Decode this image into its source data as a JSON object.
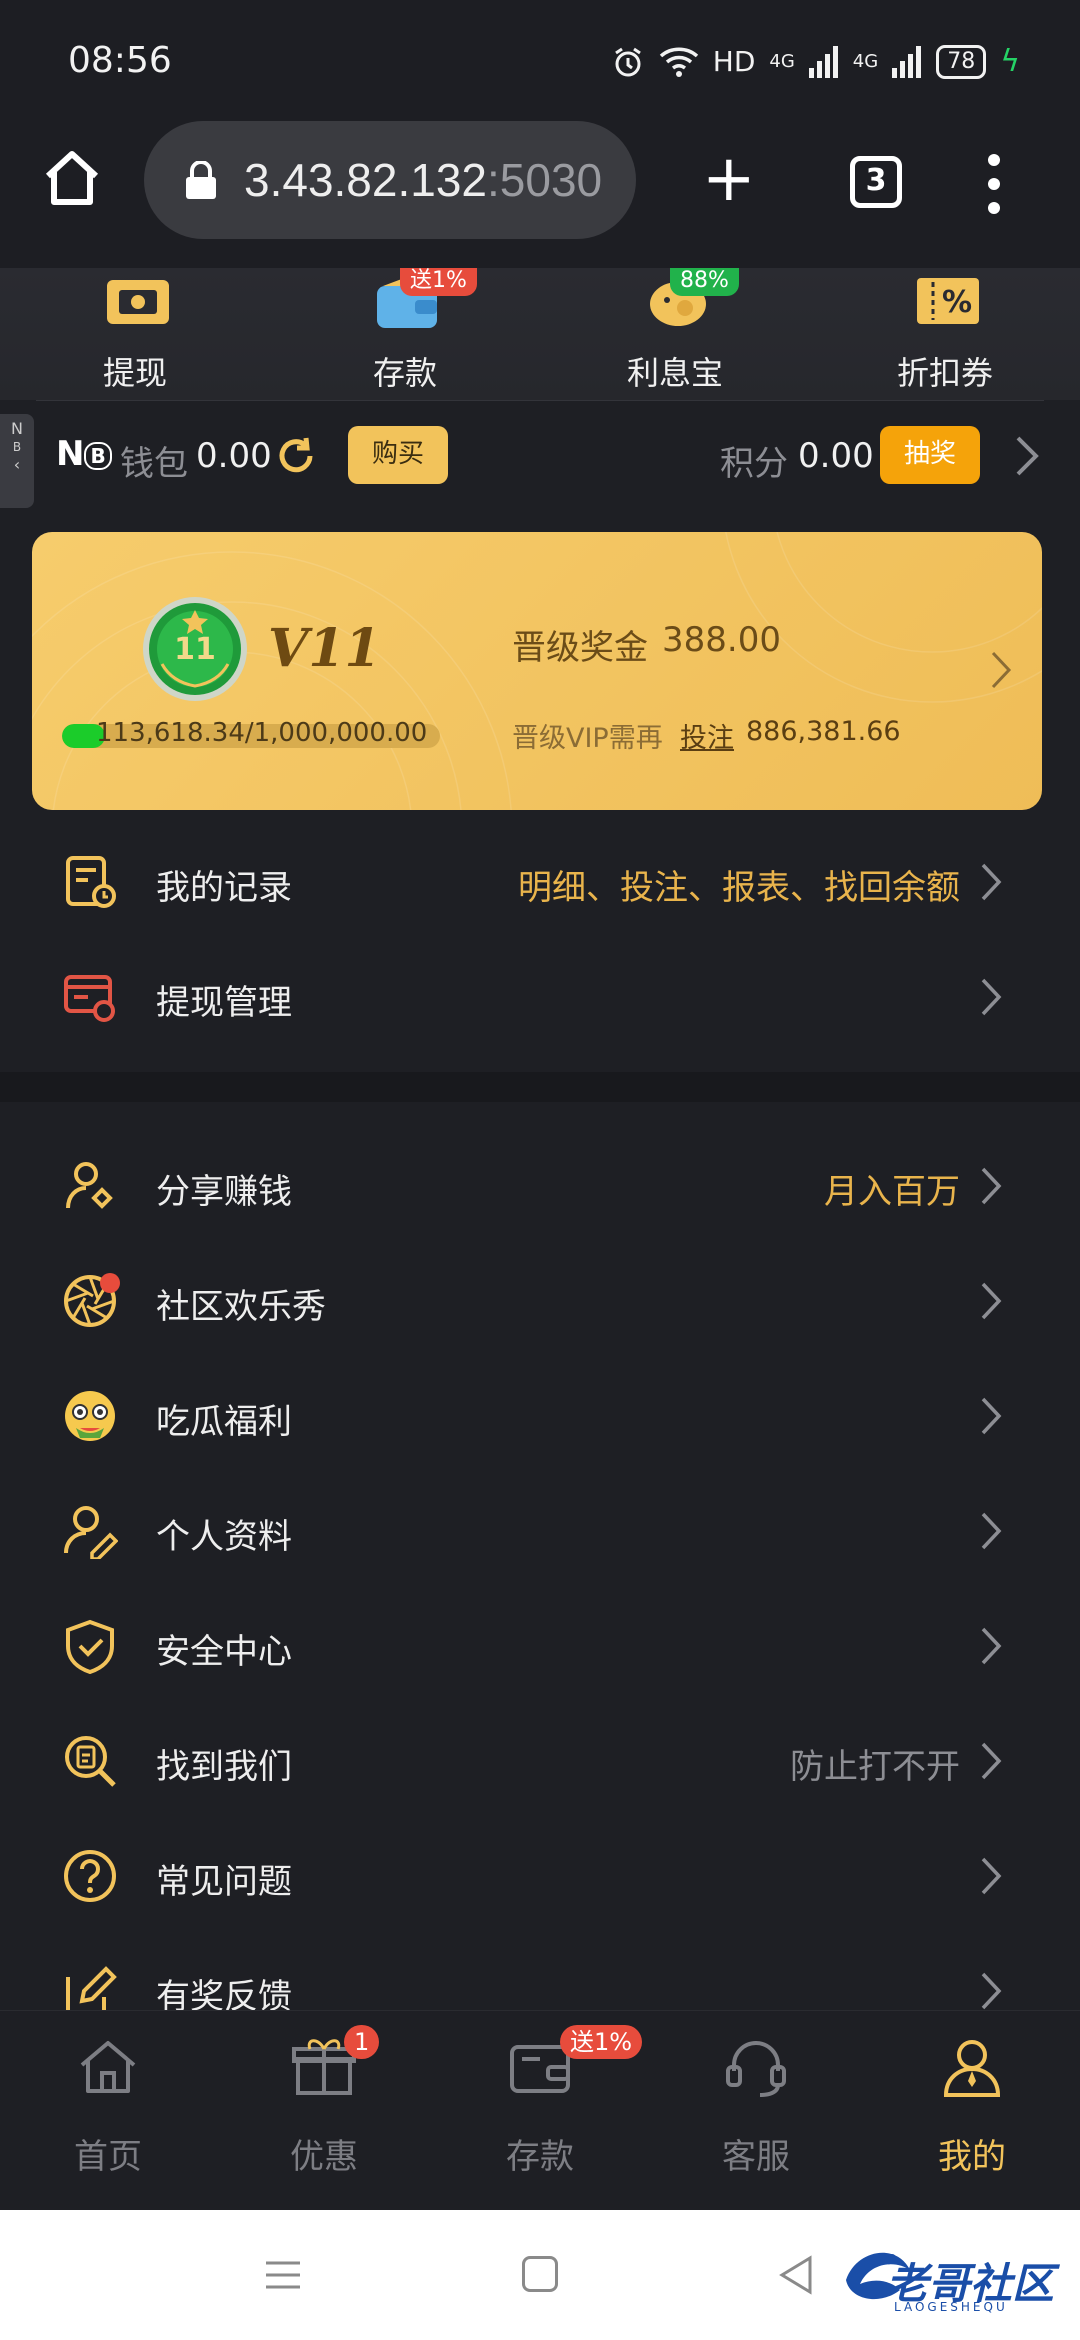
{
  "status_bar": {
    "time": "08:56",
    "network": "HD",
    "signal1": "4G",
    "signal2": "4G",
    "battery": "78"
  },
  "browser": {
    "url_host": "3.43.82.132",
    "url_port": ":5030",
    "tab_count": "3"
  },
  "quick_actions": [
    {
      "label": "提现",
      "icon": "withdraw-icon"
    },
    {
      "label": "存款",
      "icon": "wallet-icon",
      "badge": "送1%"
    },
    {
      "label": "利息宝",
      "icon": "piggy-bank-icon",
      "badge": "88%"
    },
    {
      "label": "折扣券",
      "icon": "coupon-icon"
    }
  ],
  "wallet": {
    "nb_label": "N",
    "nb_small": "B",
    "wallet_label": "钱包",
    "wallet_value": "0.00",
    "buy_label": "购买",
    "points_label": "积分",
    "points_value": "0.00",
    "draw_label": "抽奖"
  },
  "side_tab": {
    "line1": "N",
    "line2": "B"
  },
  "vip": {
    "level_badge": "11",
    "level": "V11",
    "bonus_label": "晋级奖金",
    "bonus_value": "388.00",
    "progress_text": "113,618.34/1,000,000.00",
    "progress_fraction": 0.114,
    "need_label": "晋级VIP需再",
    "need_link": "投注",
    "need_value": "886,381.66"
  },
  "menu_section1": [
    {
      "label": "我的记录",
      "hint": "明细、投注、报表、找回余额",
      "icon": "records-icon"
    },
    {
      "label": "提现管理",
      "hint": "",
      "icon": "withdraw-manage-icon"
    }
  ],
  "menu_section2": [
    {
      "label": "分享赚钱",
      "hint": "月入百万",
      "icon": "share-icon"
    },
    {
      "label": "社区欢乐秀",
      "hint": "",
      "icon": "camera-aperture-icon"
    },
    {
      "label": "吃瓜福利",
      "hint": "",
      "icon": "emoji-icon"
    },
    {
      "label": "个人资料",
      "hint": "",
      "icon": "profile-icon"
    },
    {
      "label": "安全中心",
      "hint": "",
      "icon": "shield-icon"
    },
    {
      "label": "找到我们",
      "hint": "防止打不开",
      "icon": "search-doc-icon"
    },
    {
      "label": "常见问题",
      "hint": "",
      "icon": "question-icon"
    },
    {
      "label": "有奖反馈",
      "hint": "",
      "icon": "feedback-icon"
    }
  ],
  "tabbar": [
    {
      "label": "首页",
      "icon": "home-icon"
    },
    {
      "label": "优惠",
      "icon": "gift-icon",
      "badge": "1"
    },
    {
      "label": "存款",
      "icon": "wallet-icon",
      "badge": "送1%"
    },
    {
      "label": "客服",
      "icon": "headset-icon"
    },
    {
      "label": "我的",
      "icon": "user-icon",
      "active": true
    }
  ],
  "watermark": {
    "text": "老哥社区",
    "sub": "LAOGESHEQU"
  },
  "colors": {
    "accent": "#f2c35b",
    "background": "#1e1f24",
    "badge_red": "#e74c3c",
    "progress_green": "#1bcc2a"
  }
}
